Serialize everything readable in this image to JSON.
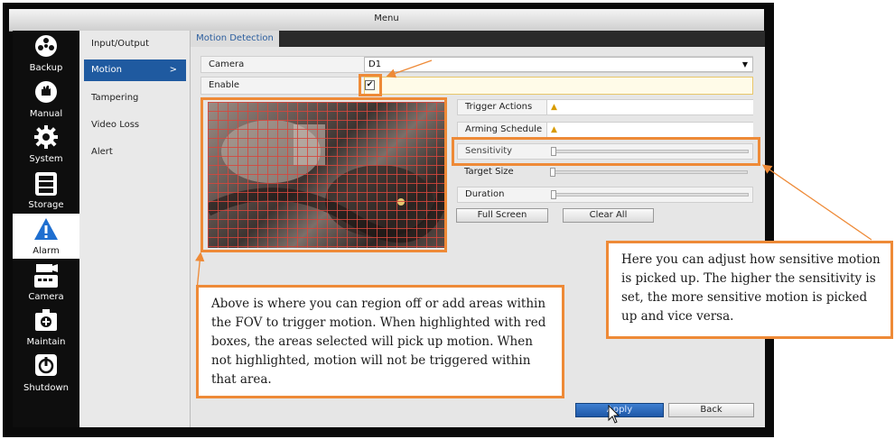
{
  "window": {
    "title": "Menu"
  },
  "sidebar": {
    "items": [
      {
        "label": "Backup",
        "icon": "backup-icon"
      },
      {
        "label": "Manual",
        "icon": "manual-icon"
      },
      {
        "label": "System",
        "icon": "gear-icon"
      },
      {
        "label": "Storage",
        "icon": "storage-icon"
      },
      {
        "label": "Alarm",
        "icon": "alarm-icon",
        "active": true
      },
      {
        "label": "Camera",
        "icon": "camera-icon"
      },
      {
        "label": "Maintain",
        "icon": "maintain-icon"
      },
      {
        "label": "Shutdown",
        "icon": "power-icon"
      }
    ]
  },
  "submenu": {
    "items": [
      {
        "label": "Input/Output"
      },
      {
        "label": "Motion",
        "active": true,
        "chevron": ">"
      },
      {
        "label": "Tampering"
      },
      {
        "label": "Video Loss"
      },
      {
        "label": "Alert"
      }
    ]
  },
  "tab": {
    "label": "Motion Detection"
  },
  "form": {
    "camera_label": "Camera",
    "camera_value": "D1",
    "enable_label": "Enable",
    "enable_checked": "✔",
    "trigger_actions": "Trigger Actions",
    "arming_schedule": "Arming Schedule",
    "sensitivity": "Sensitivity",
    "target_size": "Target Size",
    "duration": "Duration"
  },
  "buttons": {
    "full_screen": "Full Screen",
    "clear_all": "Clear All",
    "apply": "Apply",
    "back": "Back"
  },
  "notes": {
    "grid_note": "Above is where you can region off or add areas within the FOV to trigger motion.  When highlighted with red boxes, the areas selected will pick up motion.  When not highlighted, motion will not be triggered within that area.",
    "sensitivity_note": "Here you can adjust how sensitive motion is picked up.   The higher the sensitivity is set, the more sensitive motion is picked up and vice versa."
  },
  "colors": {
    "accent": "#1f5aa0",
    "annotation": "#ee8a37",
    "grid": "#d7463c"
  }
}
